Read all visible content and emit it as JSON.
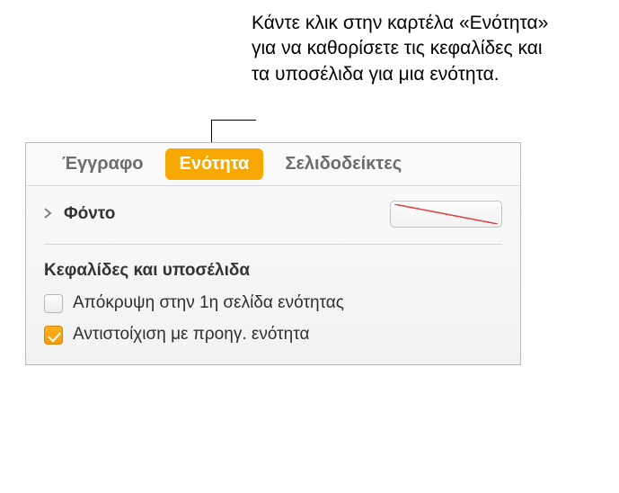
{
  "annotation": {
    "text": "Κάντε κλικ στην καρτέλα «Ενότητα» για να καθορίσετε τις κεφαλίδες και τα υποσέλιδα για μια ενότητα."
  },
  "tabs": {
    "document": "Έγγραφο",
    "section": "Ενότητα",
    "bookmarks": "Σελιδοδείκτες"
  },
  "background": {
    "label": "Φόντο"
  },
  "headersFooters": {
    "title": "Κεφαλίδες και υποσέλιδα",
    "hideOnFirst": "Απόκρυψη στην 1η σελίδα ενότητας",
    "matchPrevious": "Αντιστοίχιση με προηγ. ενότητα"
  }
}
